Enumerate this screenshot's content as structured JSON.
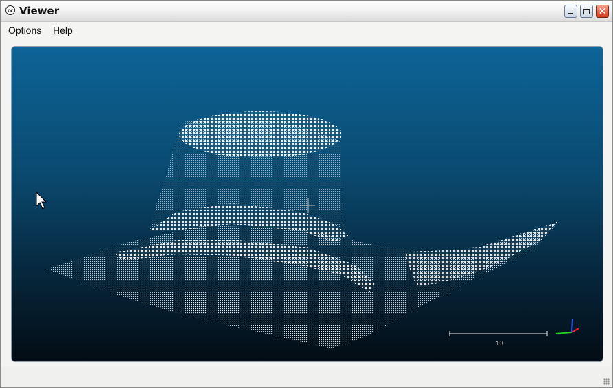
{
  "window": {
    "title": "Viewer",
    "app_icon_text": "cc",
    "min_icon": "minimize-icon",
    "max_icon": "maximize-icon",
    "close_icon": "close-icon",
    "close_glyph": "✕"
  },
  "menu": {
    "options_label": "Options",
    "help_label": "Help"
  },
  "viewport": {
    "scale_value": "10",
    "icons": [
      "mouse-cursor-icon",
      "crosshair-icon",
      "axis-trihedron-icon"
    ],
    "colors": {
      "background_top": "#0d6497",
      "background_bottom": "#030c14",
      "points": "#ffffff",
      "axis_x": "#ff2020",
      "axis_y": "#20d020",
      "axis_z": "#3060ff"
    }
  }
}
